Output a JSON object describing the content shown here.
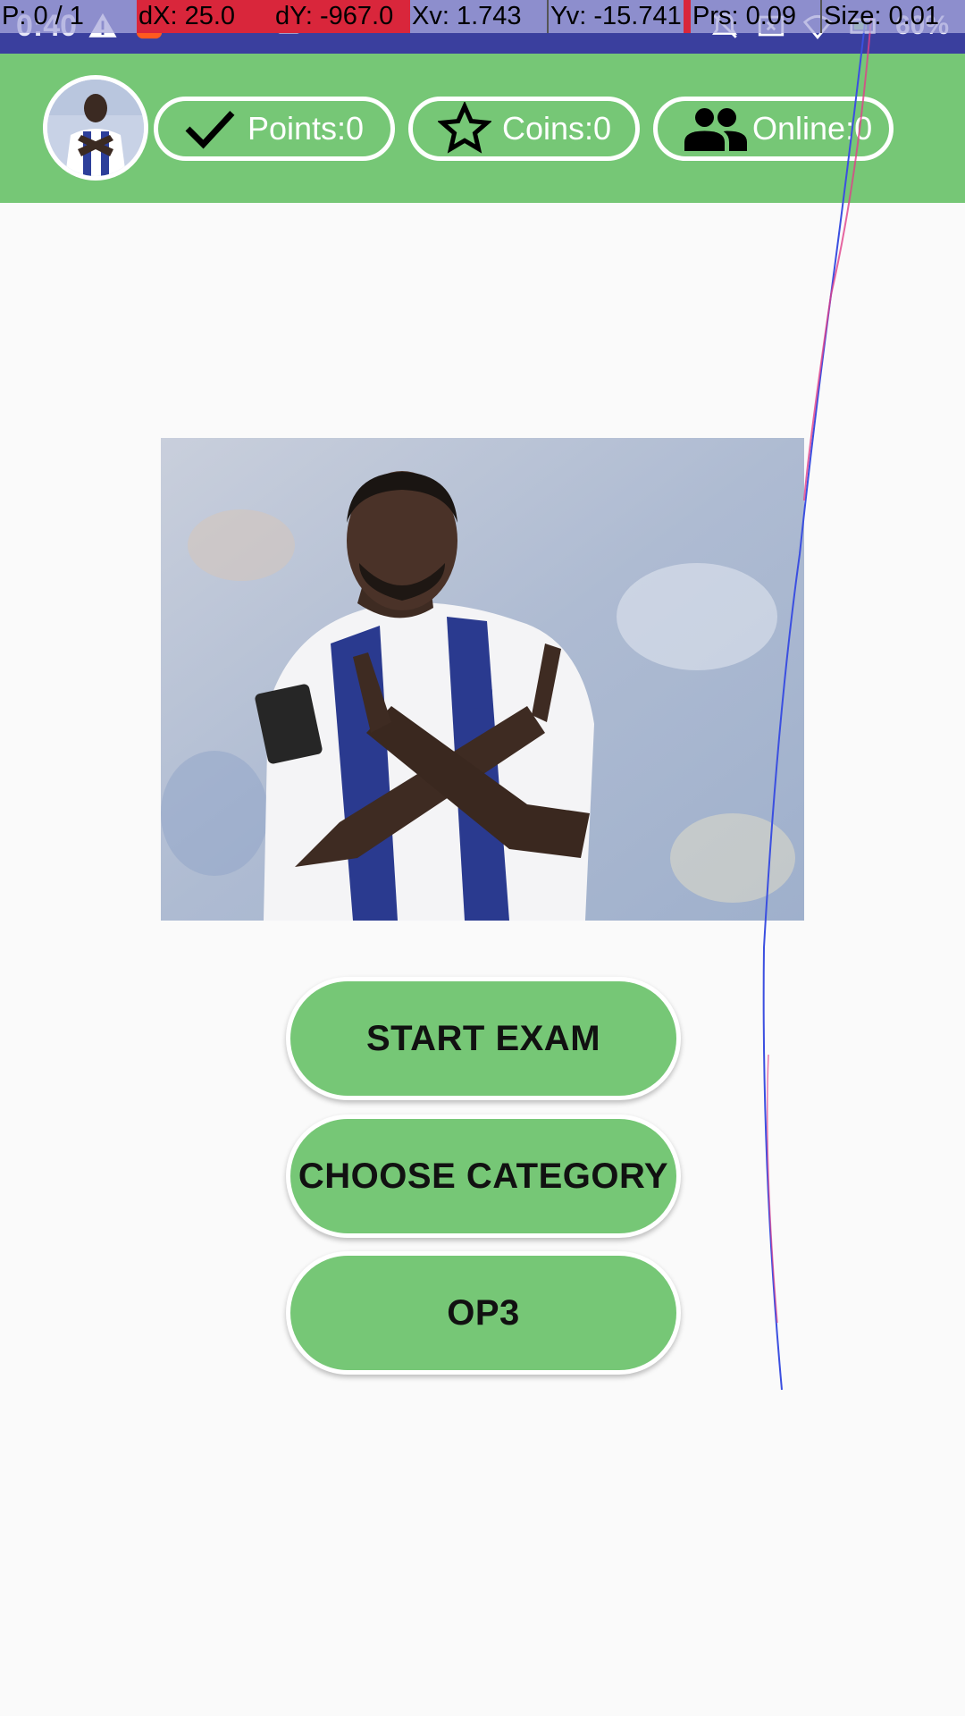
{
  "status_bar": {
    "time": "0:40",
    "battery": "60%",
    "icons_left": [
      "warning-icon",
      "app-notification-icon",
      "android-icon",
      "android-icon",
      "cloud-icon"
    ],
    "icons_right": [
      "mute-icon",
      "no-sim-icon",
      "wifi-icon",
      "battery-icon"
    ]
  },
  "debug_overlay": {
    "pointer": "P: 0 / 1",
    "dx": "dX: 25.0",
    "dy": "dY: -967.0",
    "xv": "Xv: 1.743",
    "yv": "Yv: -15.741",
    "prs": "Prs: 0.09",
    "size": "Size: 0.01"
  },
  "header": {
    "avatar": "profile-avatar",
    "points_label": "Points:0",
    "coins_label": "Coins:0",
    "online_label": "Online:0",
    "background_color": "#76c776"
  },
  "main": {
    "image": "player-photo"
  },
  "buttons": {
    "start_exam": "START EXAM",
    "choose_category": "CHOOSE CATEGORY",
    "op3": "OP3"
  },
  "colors": {
    "accent": "#76c776",
    "status_bar": "#3a3f9e",
    "background": "#fafafa"
  }
}
